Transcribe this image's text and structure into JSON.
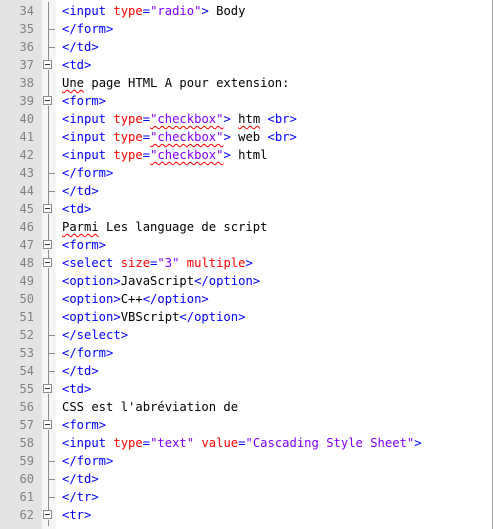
{
  "editor": {
    "lines": [
      {
        "n": "34",
        "fold": "line",
        "tokens": [
          {
            "t": "tag",
            "v": "<input "
          },
          {
            "t": "attr",
            "v": "type"
          },
          {
            "t": "tag",
            "v": "="
          },
          {
            "t": "val",
            "v": "\"radio\""
          },
          {
            "t": "tag",
            "v": ">"
          },
          {
            "t": "txt",
            "v": " Body"
          }
        ]
      },
      {
        "n": "35",
        "fold": "end",
        "tokens": [
          {
            "t": "tag",
            "v": "</form>"
          }
        ]
      },
      {
        "n": "36",
        "fold": "end",
        "tokens": [
          {
            "t": "tag",
            "v": "</td>"
          }
        ]
      },
      {
        "n": "37",
        "fold": "open",
        "tokens": [
          {
            "t": "tag",
            "v": "<td>"
          }
        ]
      },
      {
        "n": "38",
        "fold": "line",
        "tokens": [
          {
            "t": "txt",
            "v": "Une",
            "sq": true
          },
          {
            "t": "txt",
            "v": " page HTML A pour extension:"
          }
        ]
      },
      {
        "n": "39",
        "fold": "open",
        "tokens": [
          {
            "t": "tag",
            "v": "<form>"
          }
        ]
      },
      {
        "n": "40",
        "fold": "line",
        "tokens": [
          {
            "t": "tag",
            "v": "<input "
          },
          {
            "t": "attr",
            "v": "type"
          },
          {
            "t": "tag",
            "v": "="
          },
          {
            "t": "val",
            "v": "\"checkbox\"",
            "sq": true
          },
          {
            "t": "tag",
            "v": ">"
          },
          {
            "t": "txt",
            "v": " "
          },
          {
            "t": "txt",
            "v": "htm",
            "sq": true
          },
          {
            "t": "txt",
            "v": " "
          },
          {
            "t": "tag",
            "v": "<br>"
          }
        ]
      },
      {
        "n": "41",
        "fold": "line",
        "tokens": [
          {
            "t": "tag",
            "v": "<input "
          },
          {
            "t": "attr",
            "v": "type"
          },
          {
            "t": "tag",
            "v": "="
          },
          {
            "t": "val",
            "v": "\"checkbox\"",
            "sq": true
          },
          {
            "t": "tag",
            "v": ">"
          },
          {
            "t": "txt",
            "v": " web "
          },
          {
            "t": "tag",
            "v": "<br>"
          }
        ]
      },
      {
        "n": "42",
        "fold": "line",
        "tokens": [
          {
            "t": "tag",
            "v": "<input "
          },
          {
            "t": "attr",
            "v": "type"
          },
          {
            "t": "tag",
            "v": "="
          },
          {
            "t": "val",
            "v": "\"checkbox\"",
            "sq": true
          },
          {
            "t": "tag",
            "v": ">"
          },
          {
            "t": "txt",
            "v": " html"
          }
        ]
      },
      {
        "n": "43",
        "fold": "end",
        "tokens": [
          {
            "t": "tag",
            "v": "</form>"
          }
        ]
      },
      {
        "n": "44",
        "fold": "end",
        "tokens": [
          {
            "t": "tag",
            "v": "</td>"
          }
        ]
      },
      {
        "n": "45",
        "fold": "open",
        "tokens": [
          {
            "t": "tag",
            "v": "<td>"
          }
        ]
      },
      {
        "n": "46",
        "fold": "line",
        "tokens": [
          {
            "t": "txt",
            "v": "Parmi",
            "sq": true
          },
          {
            "t": "txt",
            "v": " Les language de script"
          }
        ]
      },
      {
        "n": "47",
        "fold": "open",
        "tokens": [
          {
            "t": "tag",
            "v": "<form>"
          }
        ]
      },
      {
        "n": "48",
        "fold": "open",
        "tokens": [
          {
            "t": "tag",
            "v": "<select "
          },
          {
            "t": "attr",
            "v": "size"
          },
          {
            "t": "tag",
            "v": "="
          },
          {
            "t": "val",
            "v": "\"3\""
          },
          {
            "t": "tag",
            "v": " "
          },
          {
            "t": "attr",
            "v": "multiple"
          },
          {
            "t": "tag",
            "v": ">"
          }
        ]
      },
      {
        "n": "49",
        "fold": "line",
        "tokens": [
          {
            "t": "tag",
            "v": "<option>"
          },
          {
            "t": "txt",
            "v": "JavaScript"
          },
          {
            "t": "tag",
            "v": "</option>"
          }
        ]
      },
      {
        "n": "50",
        "fold": "line",
        "tokens": [
          {
            "t": "tag",
            "v": "<option>"
          },
          {
            "t": "txt",
            "v": "C++"
          },
          {
            "t": "tag",
            "v": "</option>"
          }
        ]
      },
      {
        "n": "51",
        "fold": "line",
        "tokens": [
          {
            "t": "tag",
            "v": "<option>"
          },
          {
            "t": "txt",
            "v": "VBScript"
          },
          {
            "t": "tag",
            "v": "</option>"
          }
        ]
      },
      {
        "n": "52",
        "fold": "end",
        "tokens": [
          {
            "t": "tag",
            "v": "</select>"
          }
        ]
      },
      {
        "n": "53",
        "fold": "end",
        "tokens": [
          {
            "t": "tag",
            "v": "</form>"
          }
        ]
      },
      {
        "n": "54",
        "fold": "end",
        "tokens": [
          {
            "t": "tag",
            "v": "</td>"
          }
        ]
      },
      {
        "n": "55",
        "fold": "open",
        "tokens": [
          {
            "t": "tag",
            "v": "<td>"
          }
        ]
      },
      {
        "n": "56",
        "fold": "line",
        "tokens": [
          {
            "t": "txt",
            "v": "CSS est l'abréviation de"
          }
        ]
      },
      {
        "n": "57",
        "fold": "open",
        "tokens": [
          {
            "t": "tag",
            "v": "<form>"
          }
        ]
      },
      {
        "n": "58",
        "fold": "line",
        "tokens": [
          {
            "t": "tag",
            "v": "<input "
          },
          {
            "t": "attr",
            "v": "type"
          },
          {
            "t": "tag",
            "v": "="
          },
          {
            "t": "val",
            "v": "\"text\""
          },
          {
            "t": "tag",
            "v": " "
          },
          {
            "t": "attr",
            "v": "value"
          },
          {
            "t": "tag",
            "v": "="
          },
          {
            "t": "val",
            "v": "\"Cascading Style Sheet\""
          },
          {
            "t": "tag",
            "v": ">"
          }
        ]
      },
      {
        "n": "59",
        "fold": "end",
        "tokens": [
          {
            "t": "tag",
            "v": "</form>"
          }
        ]
      },
      {
        "n": "60",
        "fold": "end",
        "tokens": [
          {
            "t": "tag",
            "v": "</td>"
          }
        ]
      },
      {
        "n": "61",
        "fold": "end",
        "tokens": [
          {
            "t": "tag",
            "v": "</tr>"
          }
        ]
      },
      {
        "n": "62",
        "fold": "open",
        "tokens": [
          {
            "t": "tag",
            "v": "<tr>"
          }
        ]
      }
    ]
  }
}
